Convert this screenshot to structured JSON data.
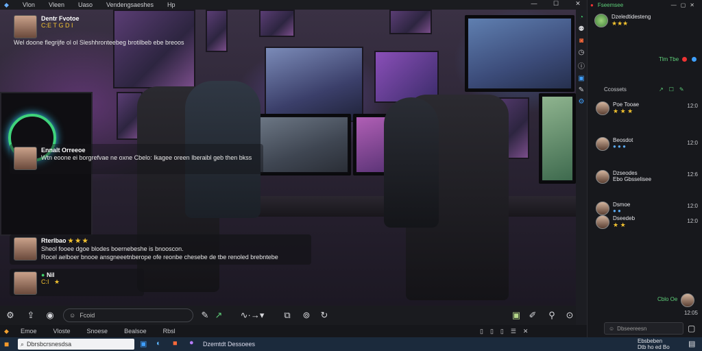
{
  "top_menu": [
    "Vlon",
    "Vleen",
    "Uaso",
    "Vendengsaeshes",
    "Hp"
  ],
  "stream": {
    "host": {
      "name": "Dentr Fvotoe",
      "sub": "C:E T G D I",
      "text": "Wel doone flegrijfe ol ol Sleshhronteebeg brotilbeb ebe breoos"
    },
    "guest1": {
      "name": "Ennalt Orreeoe",
      "text": "Wtn eoone ei borgrefvae ne oxne Cbelo: Ikagee oreen Iberaibl geb then bkss"
    },
    "guest2": {
      "name": "Rterlbao",
      "emotes": "★ ★ ★",
      "line1": "Sheol fooee dgoe blodes boernebeshe is bnooscon.",
      "line2": "Rocel aelboer bnooe ansgneeetnberope ofe reonbe chesebe de tbe renoled brebntebe"
    },
    "guest3": {
      "name": "Nil",
      "sub": "C:I   ★"
    }
  },
  "controls": {
    "chat_placeholder": "Fcoid"
  },
  "menubar": [
    "Emoe",
    "Vloste",
    "Snoese",
    "Bealsoe",
    "Rbsl"
  ],
  "taskbar": {
    "search": "Dbrsbcrsnesdsa",
    "app_label": "Dzemtdt Dessoees",
    "clock1": "Ebsbeben",
    "clock2": "Dtb ho ed Bo"
  },
  "panel": {
    "header_title": "Fseemsee",
    "channel_name": "Dzeledtidesteng",
    "channel_stars": "★★★",
    "live_label": "Tlm Tbe",
    "section_label": "Ccossets",
    "rows": [
      {
        "name": "Poe Tooae",
        "icons": "★ ★ ★",
        "time": "12:0"
      },
      {
        "name": "Beosdot",
        "icons": "● ● ●",
        "time": "12:0"
      },
      {
        "name": "Dzseodes",
        "icons": "Ebo Gbsselisee",
        "time": "12:6"
      },
      {
        "name": "Dsmoe",
        "icons": "● ●",
        "time": "12:0"
      },
      {
        "name": "Dseedeb",
        "icons": "★ ★",
        "time": "12:0"
      }
    ],
    "bottom_label": "Cblo Oe",
    "input_placeholder": "Dbseereesn",
    "time_bottom": "12:05"
  }
}
